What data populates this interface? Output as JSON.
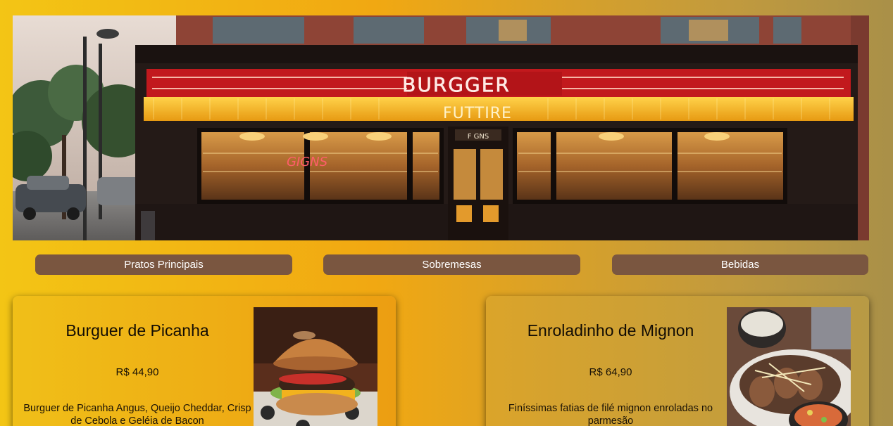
{
  "banner": {
    "sign_line1": "BURGGER",
    "sign_line2": "FUTTIRE",
    "window_neon": "GIGNS",
    "door_sign": "F GNS"
  },
  "nav": {
    "items": [
      {
        "label": "Pratos Principais"
      },
      {
        "label": "Sobremesas"
      },
      {
        "label": "Bebidas"
      }
    ]
  },
  "menu": {
    "items": [
      {
        "title": "Burguer de Picanha",
        "price": "R$ 44,90",
        "description": "Burguer de Picanha Angus, Queijo Cheddar, Crisp de Cebola e Geléia de Bacon",
        "image": "burger-photo"
      },
      {
        "title": "Enroladinho de Mignon",
        "price": "R$ 64,90",
        "description": "Finíssimas fatias de filé mignon enroladas no parmesão",
        "image": "mignon-dish-photo"
      }
    ]
  },
  "colors": {
    "nav_button": "#7a5640",
    "sign_red": "#c2191d",
    "sign_yellow": "#f0b224"
  }
}
